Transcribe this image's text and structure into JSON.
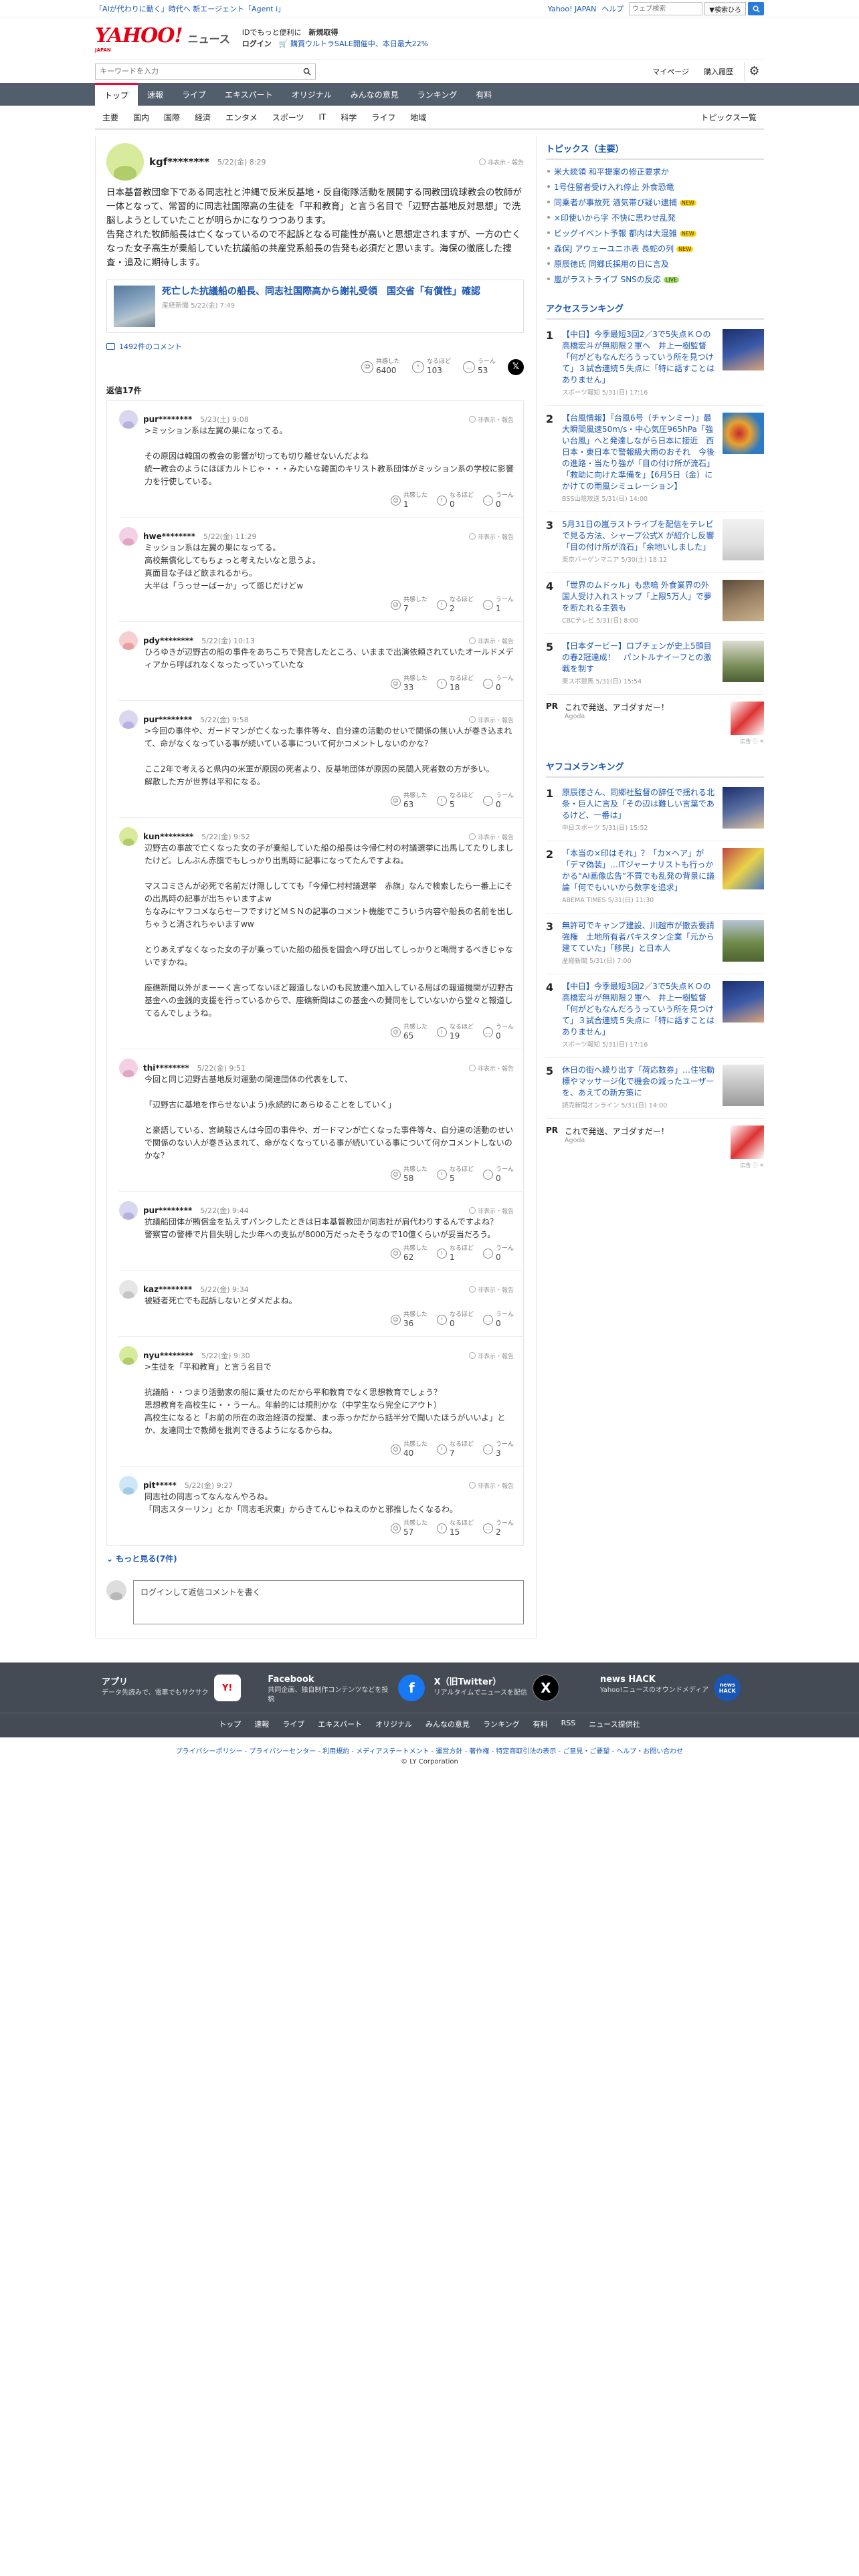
{
  "promo": {
    "left1": "「AIが代わりに動く」時代へ",
    "left2": "新エージェント「Agent i」",
    "right_links": [
      "Yahoo! JAPAN",
      "ヘルプ"
    ],
    "search_placeholder": "ウェブ検索",
    "search_select": "▼検索ひろ"
  },
  "brand": {
    "logo_text": "YAHOO!",
    "logo_sub": "JAPAN",
    "logo_news": "ニュース",
    "msg1_a": "IDでもっと便利に",
    "msg1_b": "新規取得",
    "msg2_a": "ログイン",
    "msg2_b": "🛒 購買ウルトラSALE開催中、本日最大22%"
  },
  "searchrow": {
    "placeholder": "キーワードを入力",
    "mypage": "マイページ",
    "history": "購入履歴"
  },
  "nav": [
    "トップ",
    "速報",
    "ライブ",
    "エキスパート",
    "オリジナル",
    "みんなの意見",
    "ランキング",
    "有料"
  ],
  "subnav": [
    "主要",
    "国内",
    "国際",
    "経済",
    "エンタメ",
    "スポーツ",
    "IT",
    "科学",
    "ライフ",
    "地域"
  ],
  "subnav_right": "トピックス一覧",
  "comment": {
    "user": "kgf********",
    "date": "5/22(金) 8:29",
    "flag": "非表示・報告",
    "body": "日本基督教団傘下である同志社と沖縄で反米反基地・反自衛隊活動を展開する同教団琉球教会の牧師が一体となって、常習的に同志社国際高の生徒を「平和教育」と言う名目で「辺野古基地反対思想」で洗脳しようとしていたことが明らかになりつつあります。\n告発された牧師船長は亡くなっているので不起訴となる可能性が高いと思想定されますが、一方の亡くなった女子高生が乗船していた抗議船の共産党系船長の告発も必須だと思います。海保の徹底した捜査・追及に期待します。",
    "article_title": "死亡した抗議船の船長、同志社国際高から謝礼受領　国交省「有償性」確認",
    "article_src": "産経新聞 5/22(金) 7:49",
    "comments_link": "1492件のコメント",
    "reacts": [
      {
        "label": "共感した",
        "n": "6400"
      },
      {
        "label": "なるほど",
        "n": "103"
      },
      {
        "label": "うーん",
        "n": "53"
      }
    ]
  },
  "replies_title": "返信17件",
  "replies": [
    {
      "user": "pur********",
      "date": "5/23(土) 9:08",
      "text": ">ミッション系は左翼の巣になってる。\n\nその原因は韓国の教会の影響が切っても切り離せないんだよね\n統一教会のようにほぼカルトじゃ・・・みたいな韓国のキリスト教系団体がミッション系の学校に影響力を行使している。",
      "r": [
        "1",
        "0",
        "0"
      ]
    },
    {
      "user": "hwe********",
      "date": "5/22(金) 11:29",
      "text": "ミッション系は左翼の巣になってる。\n高校無償化してもちょっと考えたいなと思うよ。\n真面目な子ほど飲まれるから。\n大半は「うっせーばーか」って感じだけどw",
      "r": [
        "7",
        "2",
        "1"
      ]
    },
    {
      "user": "pdy********",
      "date": "5/22(金) 10:13",
      "text": "ひろゆきが辺野古の船の事件をあちこちで発言したところ、いままで出演依頼されていたオールドメディアから呼ばれなくなったっていっていたな",
      "r": [
        "33",
        "18",
        "0"
      ]
    },
    {
      "user": "pur********",
      "date": "5/22(金) 9:58",
      "text": ">今回の事件や、ガードマンが亡くなった事件等々、自分達の活動のせいで関係の無い人が巻き込まれて、命がなくなっている事が続いている事について何かコメントしないのかな？\n\nここ2年で考えると県内の米軍が原因の死者より、反基地団体が原因の民間人死者数の方が多い。\n解散した方が世界は平和になる。",
      "r": [
        "63",
        "5",
        "0"
      ]
    },
    {
      "user": "kun********",
      "date": "5/22(金) 9:52",
      "text": "辺野古の事故で亡くなった女の子が乗船していた船の船長は今帰仁村の村議選挙に出馬してたりしましたけど。しんぶん赤旗でもしっかり出馬時に記事になってたんですよね。\n\nマスコミさんが必死で名前だけ隠ししてても「今帰仁村村議選挙　赤旗」なんで検索したら一番上にその出馬時の記事が出ちゃいますよw\nちなみにヤフコメならセーフですけどＭＳＮの記事のコメント機能でこういう内容や船長の名前を出しちゃうと消されちゃいますww\n\nとりあえずなくなった女の子が乗っていた船の船長を国会へ呼び出してしっかりと喝問するべきじゃないですかね。\n\n座礁新聞以外がまーーく言ってないほど報道しないのも民放連へ加入している局ばの報道機関が辺野古基金への金銭的支援を行っているからで、座礁新聞はこの基金への賛同をしていないから堂々と報道してるんでしょうね。",
      "r": [
        "65",
        "19",
        "0"
      ]
    },
    {
      "user": "thi********",
      "date": "5/22(金) 9:51",
      "text": "今回と同じ辺野古基地反対運動の関連団体の代表をして、\n\n「辺野古に基地を作らせないよう)永続的にあらゆることをしていく」\n\nと豪語している、宮崎駿さんは今回の事件や、ガードマンが亡くなった事件等々、自分達の活動のせいで関係のない人が巻き込まれて、命がなくなっている事が続いている事について何かコメントしないのかな？",
      "r": [
        "58",
        "5",
        "0"
      ]
    },
    {
      "user": "pur********",
      "date": "5/22(金) 9:44",
      "text": "抗議船団体が賄償金を払えずパンクしたときは日本基督教団か同志社が肩代わりするんですよね？\n警察官の警棒で片目失明した少年への支払が8000万だったそうなので10億くらいが妥当だろう。",
      "r": [
        "62",
        "1",
        "0"
      ]
    },
    {
      "user": "kaz********",
      "date": "5/22(金) 9:34",
      "text": "被疑者死亡でも起訴しないとダメだよね。",
      "r": [
        "36",
        "0",
        "0"
      ]
    },
    {
      "user": "nyu********",
      "date": "5/22(金) 9:30",
      "text": ">生徒を「平和教育」と言う名目で\n\n抗議船・・つまり活動家の船に乗せたのだから平和教育でなく思想教育でしょう？\n思想教育を高校生に・・うーん。年齢的には規則かな（中学生なら完全にアウト）\n高校生になると「お前の所在の政治経済の授業、まっ赤っかだから話半分で聞いたほうがいいよ」とか、友達同士で教師を批判できるようになるからね。",
      "r": [
        "40",
        "7",
        "3"
      ]
    },
    {
      "user": "pit*****",
      "date": "5/22(金) 9:27",
      "text": "同志社の同志ってなんなんやろね。\n「同志スターリン」とか「同志毛沢東」からきてんじゃねえのかと邪推したくなるわ。",
      "r": [
        "57",
        "15",
        "2"
      ]
    }
  ],
  "more_replies": "もっと見る(7件)",
  "compose_placeholder": "ログインして返信コメントを書く",
  "sidebar": {
    "topics_title": "トピックス（主要）",
    "topics": [
      {
        "t": "米大統領 和平提案の修正要求か",
        "badge": ""
      },
      {
        "t": "1号住留者受け入れ停止 外食恐竜",
        "badge": ""
      },
      {
        "t": "同乗者が事故死 酒気帯び疑い逮捕",
        "badge": "NEW"
      },
      {
        "t": "×印使いから字 不快に思わせ乱発",
        "badge": ""
      },
      {
        "t": "ビッグイベント予報 都内は大混雑",
        "badge": "NEW"
      },
      {
        "t": "森保J アウェーユニホ表 長蛇の列",
        "badge": "NEW"
      },
      {
        "t": "原辰徳氏 同郷氏採用の日に言及",
        "badge": ""
      },
      {
        "t": "嵐がラストライブ SNSの反応",
        "badge": "LIVE"
      }
    ],
    "access_title": "アクセスランキング",
    "access": [
      {
        "n": "1",
        "t": "【中日】今季最短3回2／3で5失点ＫＯの高橋宏斗が無期限２軍へ　井上一樹監督「何がどもなんだろうっていう所を見つけて」３試合連続５失点に「特に話すことはありません」",
        "s": "スポーツ報知 5/31(日) 17:16",
        "c1": "#1c2f6e",
        "c2": "#d9a37b"
      },
      {
        "n": "2",
        "t": "【台風情報】『台風6号（チャンミー）』最大瞬間風速50m/s・中心気圧965hPa「強い台風」へと発達しながら日本に接近　西日本・東日本で警報級大雨のおそれ　今後の進路・当たり強が「目の付け所が流石」「救助に向けた準備を」【6月5日（金）にかけての雨風シミュレーション】",
        "s": "BSS山陰放送 5/31(日) 14:00",
        "c1": "#c42d2d",
        "c2": "#2d7bc4"
      },
      {
        "n": "3",
        "t": "5月31日の嵐ラストライブを配信をテレビで見る方法、シャープ公式X が紹介し反響「目の付け所が流石」「余地いしました」",
        "s": "東京バーゲンマニア 5/30(土) 18:12",
        "c1": "#e9e9e9",
        "c2": "#c4c4c4"
      },
      {
        "n": "4",
        "t": "「世界のムドゥル」も悲鳴 外食業界の外国人受け入れストップ「上限5万人」で夢を断たれる主張も",
        "s": "CBCテレビ 5/31(日) 8:00",
        "c1": "#5b4a3a",
        "c2": "#c9b08c"
      },
      {
        "n": "5",
        "t": "【日本ダービー】ロブチェンが史上5頭目の春2冠達成！　パントルナイーフとの激戦を制す",
        "s": "東スポ競馬 5/31(日) 15:54",
        "c1": "#7b8f5a",
        "c2": "#dcdcd0"
      }
    ],
    "pr1": {
      "label": "PR",
      "t": "これで発送、アゴダすだー！",
      "s": "Agoda"
    },
    "yafukome_title": "ヤフコメランキング",
    "yafukome": [
      {
        "n": "1",
        "t": "原辰徳さん、同郷社監督の辞任で揺れる北条・巨人に言及「その辺は難しい言葉であるけど、一番は」",
        "s": "中日スポーツ 5/31(日) 15:52",
        "c1": "#1c2f6e",
        "c2": "#e0c3a0"
      },
      {
        "n": "2",
        "t": "「本当の×印はそれ」？「カ×ヘア」が「デマ偽装」…ITジャーナリストも行っかかる“AI画像広告”不買でも乱発の背景に議論「何でもいいから数字を追求」",
        "s": "ABEMA TIMES 5/31(日) 11:30",
        "c1": "#c04646",
        "c2": "#e9d24a"
      },
      {
        "n": "3",
        "t": "無許可でキャンプ建設、川越市が撤去要請強権　土地所有者パキスタン企業「元から建てていた」「移民」と日本人",
        "s": "産経新聞 5/31(日) 7:00",
        "c1": "#6e8a48",
        "c2": "#b7c4d6"
      },
      {
        "n": "4",
        "t": "【中日】今季最短3回2／3で5失点ＫＯの高橋宏斗が無期限２軍へ　井上一樹監督「何がどもなんだろうっていう所を見つけて」３試合連続５失点に「特に話すことはありません」",
        "s": "スポーツ報知 5/31(日) 17:16",
        "c1": "#1c2f6e",
        "c2": "#d9a37b"
      },
      {
        "n": "5",
        "t": "休日の街へ繰り出す「荷応数券」…住宅動標やマッサージ化で機会の減ったユーザーを、あえての新方策に",
        "s": "読売新聞オンライン 5/31(日) 14:00",
        "c1": "#e8e8e8",
        "c2": "#9a9a9a"
      }
    ],
    "pr2": {
      "label": "PR",
      "t": "これで発送、アゴダすだー！",
      "s": "Agoda"
    },
    "ad_note": "広告 ⓘ ✕"
  },
  "footer": {
    "cols": [
      {
        "t": "アプリ",
        "d": "データ先読みで、電車でもサクサク",
        "icon": "Y!",
        "color": "#ffffff"
      },
      {
        "t": "Facebook",
        "d": "共同企画、独自制作コンテンツなどを投稿",
        "icon": "f",
        "color": "#1877f2"
      },
      {
        "t": "X（旧Twitter）",
        "d": "リアルタイムでニュースを配信",
        "icon": "X",
        "color": "#000000"
      },
      {
        "t": "news HACK",
        "d": "Yahoo!ニュースのオウンドメディア",
        "icon": "news HACK",
        "color": "#1a56b3"
      }
    ],
    "nav": [
      "トップ",
      "速報",
      "ライブ",
      "エキスパート",
      "オリジナル",
      "みんなの意見",
      "ランキング",
      "有料",
      "RSS",
      "ニュース提供社"
    ],
    "legal": "プライバシーポリシー - プライバシーセンター - 利用規約 - メディアステートメント - 運営方針 - 著作権 - 特定商取引法の表示 - ご意見・ご要望 - ヘルプ・お問い合わせ",
    "copy": "© LY Corporation"
  },
  "colors": {
    "accent": "#ff0033",
    "nav": "#525e6b",
    "link": "#1a56b3",
    "footer": "#444b55"
  }
}
